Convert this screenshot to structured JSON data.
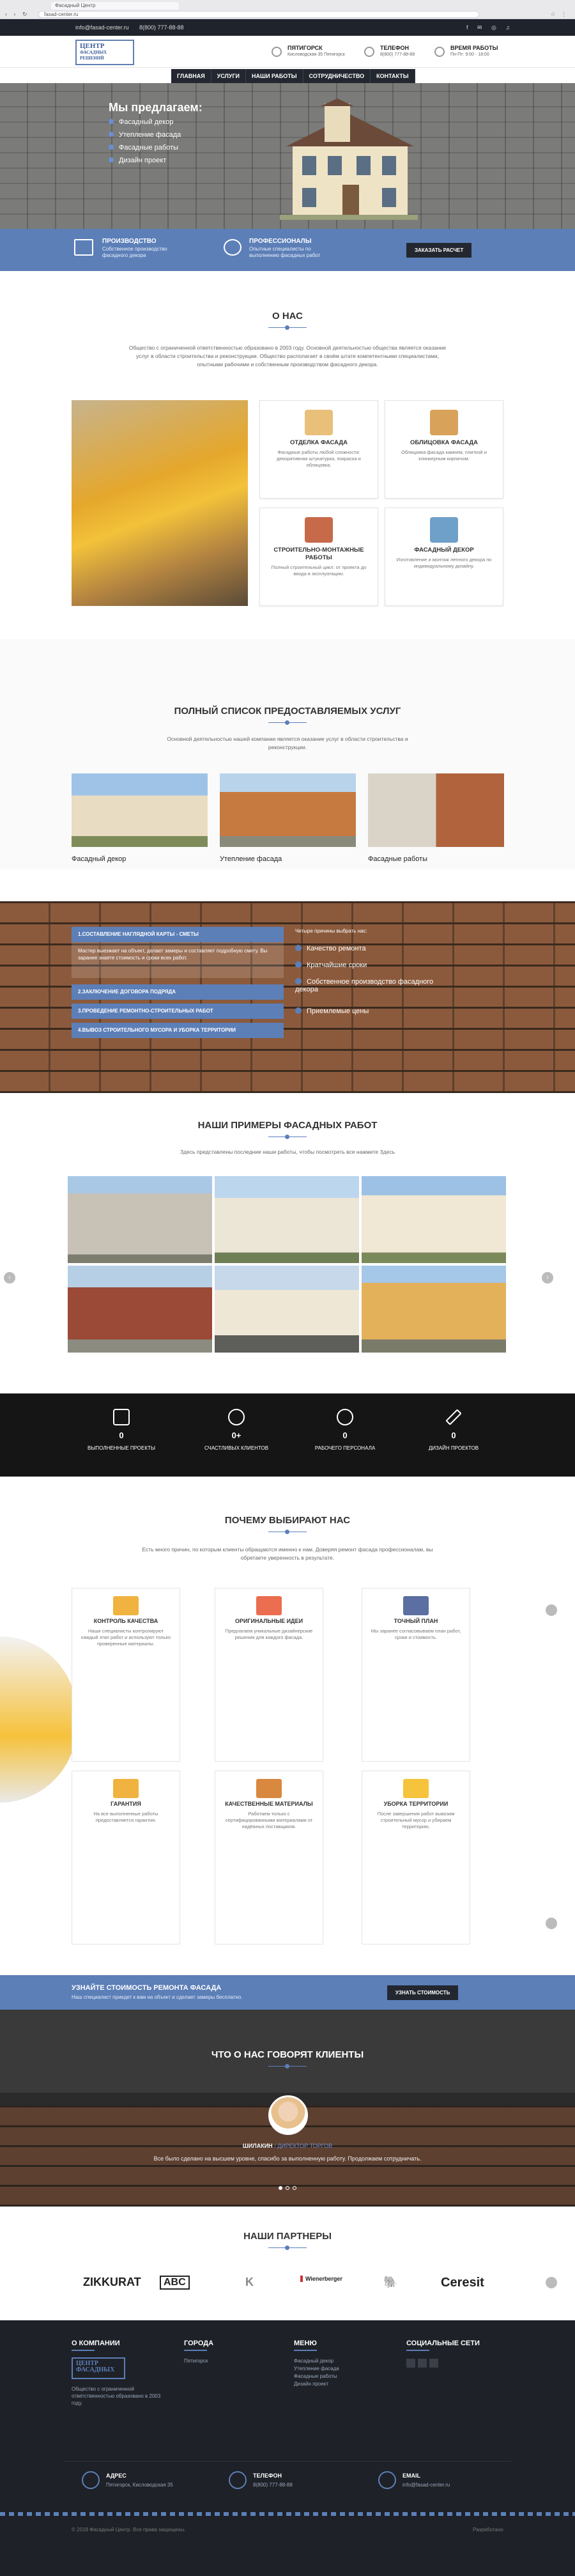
{
  "browser": {
    "tab_title": "Фасадный Центр",
    "address": "fasad-center.ru",
    "nav": "‹ › ↻",
    "menu": "☆ ⋮"
  },
  "topbar": {
    "email": "info@fasad-center.ru",
    "phone": "8(800) 777-88-88",
    "socials": "f ✉ ◎ ♫"
  },
  "logo": {
    "line1": "ЦЕНТР",
    "line2": "ФАСАДНЫХ",
    "line3": "РЕШЕНИЙ"
  },
  "header": {
    "city": {
      "title": "ПЯТИГОРСК",
      "sub": "Кисловодская 35 Пятигорск"
    },
    "phone": {
      "title": "ТЕЛЕФОН",
      "sub": "8(800) 777-88-88"
    },
    "hours": {
      "title": "ВРЕМЯ РАБОТЫ",
      "sub": "Пн-Пт: 9:00 - 18:00"
    }
  },
  "nav": [
    "ГЛАВНАЯ",
    "УСЛУГИ",
    "НАШИ РАБОТЫ",
    "СОТРУДНИЧЕСТВО",
    "КОНТАКТЫ"
  ],
  "hero": {
    "title": "Мы предлагаем:",
    "items": [
      "Фасадный декор",
      "Утепление фасада",
      "Фасадные работы",
      "Дизайн проект"
    ]
  },
  "strip": {
    "f1": {
      "title": "ПРОИЗВОДСТВО",
      "sub": "Собственное производство фасадного декора"
    },
    "f2": {
      "title": "ПРОФЕССИОНАЛЫ",
      "sub": "Опытные специалисты по выполнению фасадных работ"
    },
    "cta": "ЗАКАЗАТЬ РАСЧЕТ"
  },
  "about": {
    "title": "О НАС",
    "text": "Общество с ограниченной ответственностью образовано в 2003 году. Основной деятельностью общества является оказание услуг в области строительства и реконструкции. Общество располагает в своём штате компетентными специалистами, опытными рабочими и собственным производством фасадного декора.",
    "cards": [
      {
        "title": "ОТДЕЛКА ФАСАДА",
        "desc": "Фасадные работы любой сложности: декоративная штукатурка, покраска и облицовка."
      },
      {
        "title": "ОБЛИЦОВКА ФАСАДА",
        "desc": "Облицовка фасада камнем, плиткой и клинкерным кирпичом."
      },
      {
        "title": "СТРОИТЕЛЬНО-МОНТАЖНЫЕ РАБОТЫ",
        "desc": "Полный строительный цикл: от проекта до ввода в эксплуатацию."
      },
      {
        "title": "ФАСАДНЫЙ ДЕКОР",
        "desc": "Изготовление и монтаж лепного декора по индивидуальному дизайну."
      }
    ]
  },
  "services": {
    "title": "ПОЛНЫЙ СПИСОК ПРЕДОСТАВЛЯЕМЫХ УСЛУГ",
    "text": "Основной деятельностью нашей компании является оказание услуг в области строительства и реконструкции.",
    "items": [
      "Фасадный декор",
      "Утепление фасада",
      "Фасадные работы"
    ]
  },
  "process": {
    "steps": [
      "1.СОСТАВЛЕНИЕ НАГЛЯДНОЙ КАРТЫ - СМЕТЫ",
      "2.ЗАКЛЮЧЕНИЕ ДОГОВОРА ПОДРЯДА",
      "3.ПРОВЕДЕНИЕ РЕМОНТНО-СТРОИТЕЛЬНЫХ РАБОТ",
      "4.ВЫВОЗ СТРОИТЕЛЬНОГО МУСОРА И УБОРКА ТЕРРИТОРИИ"
    ],
    "step1_text": "Мастер выезжает на объект, делает замеры и составляет подробную смету. Вы заранее знаете стоимость и сроки всех работ.",
    "lead": "Четыре причины выбрать нас:",
    "checks": [
      "Качество ремонта",
      "Кратчайшие сроки",
      "Собственное производство фасадного декора",
      "Приемлемые цены"
    ]
  },
  "gallery": {
    "title": "НАШИ ПРИМЕРЫ ФАСАДНЫХ РАБОТ",
    "text": "Здесь представлены последние наши работы, чтобы посмотреть все нажмите Здесь",
    "prev": "‹",
    "next": "›"
  },
  "counters": [
    {
      "n": "0",
      "label": "ВЫПОЛНЕННЫЕ ПРОЕКТЫ"
    },
    {
      "n": "0+",
      "label": "СЧАСТЛИВЫХ КЛИЕНТОВ"
    },
    {
      "n": "0",
      "label": "РАБОЧЕГО ПЕРСОНАЛА"
    },
    {
      "n": "0",
      "label": "ДИЗАЙН ПРОЕКТОВ"
    }
  ],
  "why": {
    "title": "ПОЧЕМУ ВЫБИРАЮТ НАС",
    "text": "Есть много причин, по которым клиенты обращаются именно к нам. Доверяя ремонт фасада профессионалам, вы обретаете уверенность в результате.",
    "cards": [
      {
        "title": "КОНТРОЛЬ КАЧЕСТВА",
        "desc": "Наши специалисты контролируют каждый этап работ и используют только проверенные материалы."
      },
      {
        "title": "ОРИГИНАЛЬНЫЕ ИДЕИ",
        "desc": "Предлагаем уникальные дизайнерские решения для каждого фасада."
      },
      {
        "title": "ТОЧНЫЙ ПЛАН",
        "desc": "Мы заранее согласовываем план работ, сроки и стоимость."
      },
      {
        "title": "ГАРАНТИЯ",
        "desc": "На все выполненные работы предоставляется гарантия."
      },
      {
        "title": "КАЧЕСТВЕННЫЕ МАТЕРИАЛЫ",
        "desc": "Работаем только с сертифицированными материалами от надёжных поставщиков."
      },
      {
        "title": "УБОРКА ТЕРРИТОРИИ",
        "desc": "После завершения работ вывозим строительный мусор и убираем территорию."
      }
    ]
  },
  "cta": {
    "title": "УЗНАЙТЕ СТОИМОСТЬ РЕМОНТА ФАСАДА",
    "sub": "Наш специалист приедет к вам на объект и сделает замеры бесплатно.",
    "button": "УЗНАТЬ СТОИМОСТЬ"
  },
  "testimonials": {
    "title": "ЧТО О НАС ГОВОРЯТ КЛИЕНТЫ",
    "name": "ШИЛАКИН",
    "role": "/ ДИРЕКТОР ТОРГОВ",
    "quote": "Все было сделано на высшем уровне, спасибо за выполненную работу. Продолжаем сотрудничать."
  },
  "partners": {
    "title": "НАШИ ПАРТНЕРЫ",
    "logos": [
      "ZIKKURAT",
      "ABC",
      "K",
      "Wienerberger",
      "🐘",
      "Ceresit"
    ]
  },
  "footer": {
    "about_h": "О КОМПАНИИ",
    "about_text": "Общество с ограниченной ответственностью образовано в 2003 году.",
    "city_h": "ГОРОДА",
    "city": "Пятигорск",
    "menu_h": "МЕНЮ",
    "menu": [
      "Фасадный декор",
      "Утепление фасада",
      "Фасадные работы",
      "Дизайн проект"
    ],
    "social_h": "СОЦИАЛЬНЫЕ СЕТИ",
    "addr_h": "АДРЕС",
    "addr": "Пятигорск, Кисловодская 35",
    "phone_h": "ТЕЛЕФОН",
    "phone": "8(800) 777-88-88",
    "email_h": "EMAIL",
    "email": "info@fasad-center.ru",
    "copy": "© 2018 Фасадный Центр. Все права защищены.",
    "dev": "Разработано"
  },
  "colors": {
    "accent": "#5c7fb8",
    "dark": "#1e2127"
  }
}
